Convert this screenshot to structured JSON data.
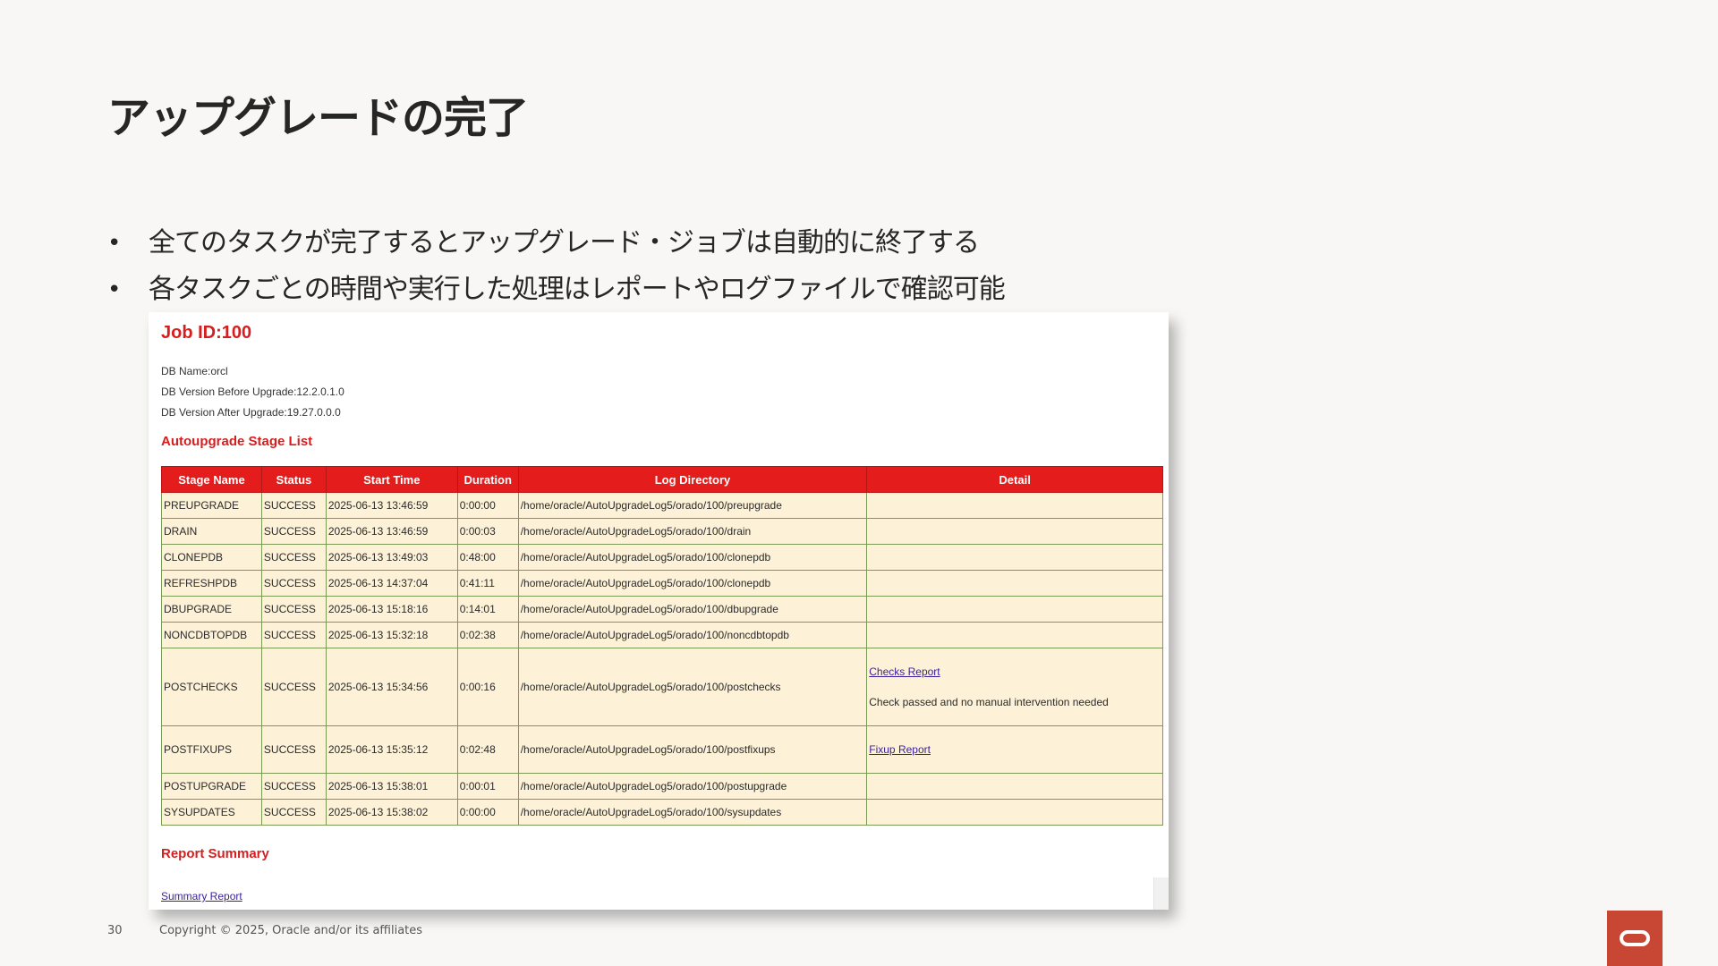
{
  "slide": {
    "title": "アップグレードの完了",
    "bullets": [
      "全てのタスクが完了するとアップグレード・ジョブは自動的に終了する",
      "各タスクごとの時間や実行した処理はレポートやログファイルで確認可能"
    ]
  },
  "report": {
    "job_title": "Job ID:100",
    "meta": [
      "DB Name:orcl",
      "DB Version Before Upgrade:12.2.0.1.0",
      "DB Version After Upgrade:19.27.0.0.0"
    ],
    "stage_list_title": "Autoupgrade Stage List",
    "columns": [
      "Stage Name",
      "Status",
      "Start Time",
      "Duration",
      "Log Directory",
      "Detail"
    ],
    "rows": [
      {
        "stage": "PREUPGRADE",
        "status": "SUCCESS",
        "start": "2025-06-13 13:46:59",
        "duration": "0:00:00",
        "log": "/home/oracle/AutoUpgradeLog5/orado/100/preupgrade",
        "detail_link": "",
        "detail_note": ""
      },
      {
        "stage": "DRAIN",
        "status": "SUCCESS",
        "start": "2025-06-13 13:46:59",
        "duration": "0:00:03",
        "log": "/home/oracle/AutoUpgradeLog5/orado/100/drain",
        "detail_link": "",
        "detail_note": ""
      },
      {
        "stage": "CLONEPDB",
        "status": "SUCCESS",
        "start": "2025-06-13 13:49:03",
        "duration": "0:48:00",
        "log": "/home/oracle/AutoUpgradeLog5/orado/100/clonepdb",
        "detail_link": "",
        "detail_note": ""
      },
      {
        "stage": "REFRESHPDB",
        "status": "SUCCESS",
        "start": "2025-06-13 14:37:04",
        "duration": "0:41:11",
        "log": "/home/oracle/AutoUpgradeLog5/orado/100/clonepdb",
        "detail_link": "",
        "detail_note": ""
      },
      {
        "stage": "DBUPGRADE",
        "status": "SUCCESS",
        "start": "2025-06-13 15:18:16",
        "duration": "0:14:01",
        "log": "/home/oracle/AutoUpgradeLog5/orado/100/dbupgrade",
        "detail_link": "",
        "detail_note": ""
      },
      {
        "stage": "NONCDBTOPDB",
        "status": "SUCCESS",
        "start": "2025-06-13 15:32:18",
        "duration": "0:02:38",
        "log": "/home/oracle/AutoUpgradeLog5/orado/100/noncdbtopdb",
        "detail_link": "",
        "detail_note": ""
      },
      {
        "stage": "POSTCHECKS",
        "status": "SUCCESS",
        "start": "2025-06-13 15:34:56",
        "duration": "0:00:16",
        "log": "/home/oracle/AutoUpgradeLog5/orado/100/postchecks",
        "detail_link": "Checks Report",
        "detail_note": "Check passed and no manual intervention needed"
      },
      {
        "stage": "POSTFIXUPS",
        "status": "SUCCESS",
        "start": "2025-06-13 15:35:12",
        "duration": "0:02:48",
        "log": "/home/oracle/AutoUpgradeLog5/orado/100/postfixups",
        "detail_link": "Fixup Report",
        "detail_note": ""
      },
      {
        "stage": "POSTUPGRADE",
        "status": "SUCCESS",
        "start": "2025-06-13 15:38:01",
        "duration": "0:00:01",
        "log": "/home/oracle/AutoUpgradeLog5/orado/100/postupgrade",
        "detail_link": "",
        "detail_note": ""
      },
      {
        "stage": "SYSUPDATES",
        "status": "SUCCESS",
        "start": "2025-06-13 15:38:02",
        "duration": "0:00:00",
        "log": "/home/oracle/AutoUpgradeLog5/orado/100/sysupdates",
        "detail_link": "",
        "detail_note": ""
      }
    ],
    "summary_title": "Report Summary",
    "summary_link": "Summary Report"
  },
  "footer": {
    "page_number": "30",
    "copyright": "Copyright © 2025, Oracle and/or its affiliates"
  },
  "colors": {
    "accent_red": "#e41c1c",
    "row_bg": "#fdf2d8",
    "oracle_logo": "#c74634"
  },
  "icons": {
    "logo": "oracle-logo-icon"
  }
}
